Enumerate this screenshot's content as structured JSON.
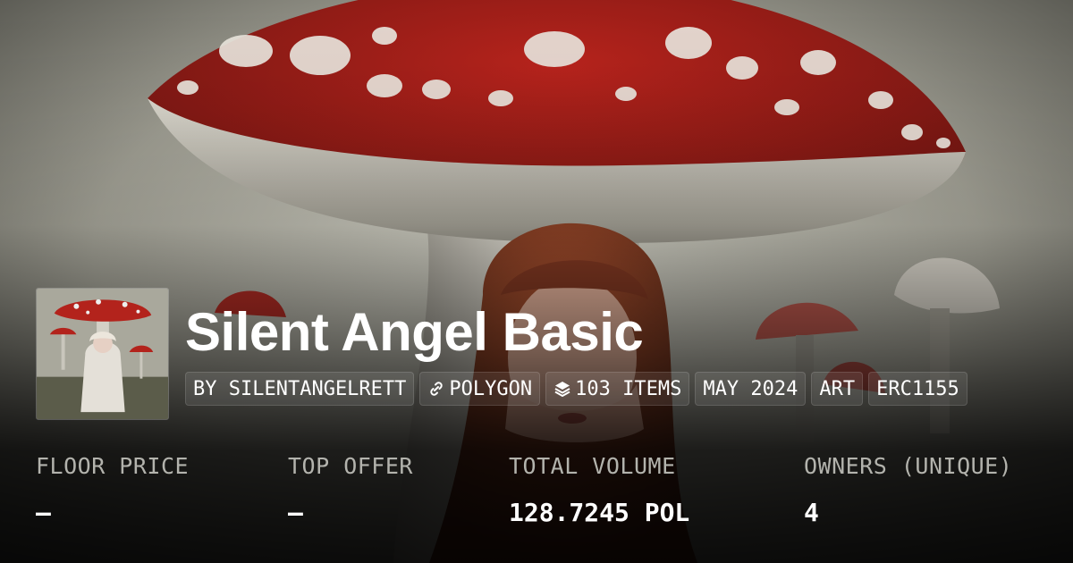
{
  "collection": {
    "name": "Silent Angel Basic"
  },
  "tags": [
    {
      "label": "BY SILENTANGELRETT",
      "icon": ""
    },
    {
      "label": "POLYGON",
      "icon": "link-icon"
    },
    {
      "label": "103 ITEMS",
      "icon": "layers-icon"
    },
    {
      "label": "MAY 2024",
      "icon": ""
    },
    {
      "label": "ART",
      "icon": ""
    },
    {
      "label": "ERC1155",
      "icon": ""
    }
  ],
  "stats": [
    {
      "label": "FLOOR PRICE",
      "value": "—"
    },
    {
      "label": "TOP OFFER",
      "value": "—"
    },
    {
      "label": "TOTAL VOLUME",
      "value": "128.7245 POL"
    },
    {
      "label": "OWNERS (UNIQUE)",
      "value": "4"
    }
  ],
  "colors": {
    "background": "#1a1a18",
    "text_primary": "#ffffff",
    "text_muted": "#b3b3ad",
    "mushroom_red": "#a31e1a"
  }
}
